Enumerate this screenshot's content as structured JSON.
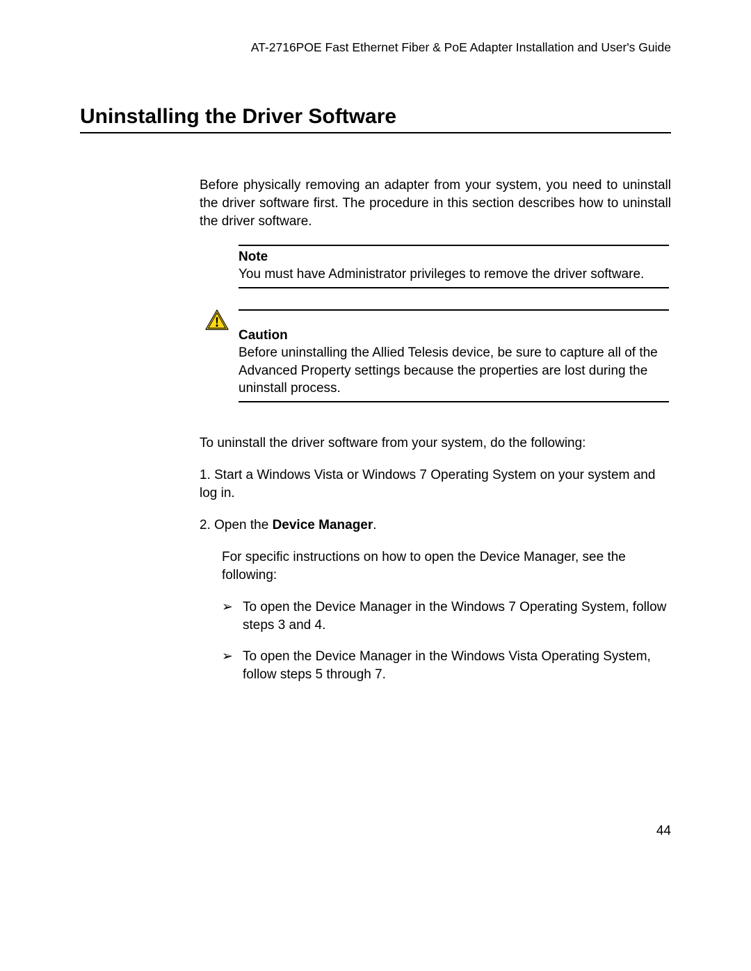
{
  "header": {
    "running_title": "AT-2716POE Fast Ethernet Fiber & PoE Adapter Installation and User's Guide"
  },
  "section": {
    "heading": "Uninstalling the Driver Software",
    "intro": "Before physically removing an adapter from your system, you need to uninstall the driver software first. The procedure in this section describes how to uninstall the driver software.",
    "note": {
      "title": "Note",
      "text": "You must have Administrator privileges to remove the driver software."
    },
    "caution": {
      "title": "Caution",
      "text": "Before uninstalling the Allied Telesis device, be sure to capture all of the Advanced Property settings because the properties are lost during the uninstall process."
    },
    "lead": "To uninstall the driver software from your system, do the following:",
    "step1": "1.  Start a Windows Vista or Windows 7 Operating System on your system and log in.",
    "step2_prefix": "2.  Open the ",
    "step2_bold": "Device Manager",
    "step2_suffix": ".",
    "sub_para": "For specific instructions on how to open the Device Manager, see the following:",
    "bullets": [
      "To open the Device Manager in the Windows 7 Operating System, follow steps 3 and 4.",
      "To open the Device Manager in the Windows Vista Operating System, follow steps 5 through 7."
    ],
    "page_number": "44"
  }
}
